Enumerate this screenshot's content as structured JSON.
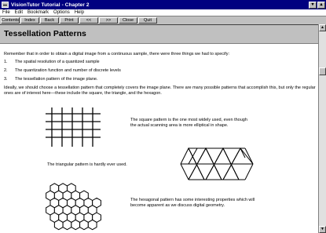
{
  "window": {
    "title": "VisionTutor Tutorial - Chapter 2"
  },
  "menu": [
    "File",
    "Edit",
    "Bookmark",
    "Options",
    "Help"
  ],
  "toolbar": [
    "Contents",
    "Index",
    "Back",
    "Print",
    "<<",
    ">>",
    "Close",
    "Quit"
  ],
  "page": {
    "heading": "Tessellation Patterns",
    "intro": "Remember that in order to obtain a digital image from a continuous sample, there were three things we had to specify:",
    "items": [
      {
        "num": "1.",
        "text": "The spatial resolution of a quantized sample"
      },
      {
        "num": "2.",
        "text": "The quantization function and number of discrete levels"
      },
      {
        "num": "3.",
        "text": "The tessellation pattern of the image plane."
      }
    ],
    "paragraph": "Ideally, we should choose a tessellation pattern that completely covers the image plane.  There are many possible patterns that accomplish this, but only the regular ones are of interest here—these include the square, the triangle, and the hexagon.",
    "square_caption": "The square pattern is the one most widely used, even though the actual scanning area is more elliptical in shape.",
    "triangle_caption": "The triangular pattern is hardly ever used.",
    "hexagon_caption": "The hexagonal pattern has some interesting properties which will become apparent as we discuss digital geometry."
  },
  "icons": {
    "system_menu": "system-menu-icon",
    "minimize": "minimize-icon",
    "maximize": "maximize-icon",
    "scroll_up": "scroll-up-arrow-icon",
    "scroll_down": "scroll-down-arrow-icon"
  }
}
